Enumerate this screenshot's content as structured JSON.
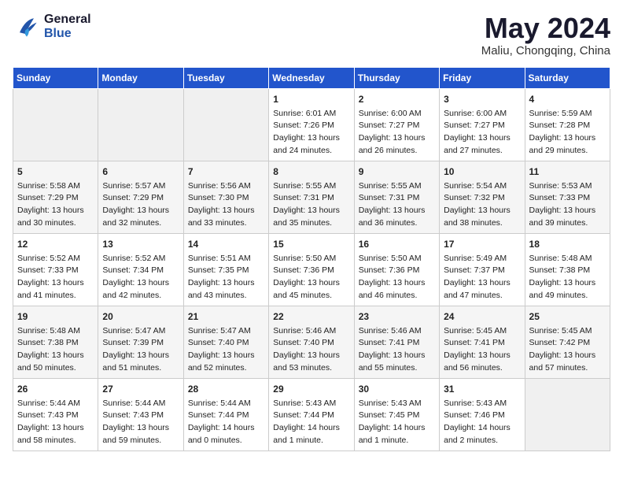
{
  "logo": {
    "line1": "General",
    "line2": "Blue"
  },
  "title": "May 2024",
  "location": "Maliu, Chongqing, China",
  "days_header": [
    "Sunday",
    "Monday",
    "Tuesday",
    "Wednesday",
    "Thursday",
    "Friday",
    "Saturday"
  ],
  "weeks": [
    [
      {
        "day": "",
        "content": ""
      },
      {
        "day": "",
        "content": ""
      },
      {
        "day": "",
        "content": ""
      },
      {
        "day": "1",
        "content": "Sunrise: 6:01 AM\nSunset: 7:26 PM\nDaylight: 13 hours\nand 24 minutes."
      },
      {
        "day": "2",
        "content": "Sunrise: 6:00 AM\nSunset: 7:27 PM\nDaylight: 13 hours\nand 26 minutes."
      },
      {
        "day": "3",
        "content": "Sunrise: 6:00 AM\nSunset: 7:27 PM\nDaylight: 13 hours\nand 27 minutes."
      },
      {
        "day": "4",
        "content": "Sunrise: 5:59 AM\nSunset: 7:28 PM\nDaylight: 13 hours\nand 29 minutes."
      }
    ],
    [
      {
        "day": "5",
        "content": "Sunrise: 5:58 AM\nSunset: 7:29 PM\nDaylight: 13 hours\nand 30 minutes."
      },
      {
        "day": "6",
        "content": "Sunrise: 5:57 AM\nSunset: 7:29 PM\nDaylight: 13 hours\nand 32 minutes."
      },
      {
        "day": "7",
        "content": "Sunrise: 5:56 AM\nSunset: 7:30 PM\nDaylight: 13 hours\nand 33 minutes."
      },
      {
        "day": "8",
        "content": "Sunrise: 5:55 AM\nSunset: 7:31 PM\nDaylight: 13 hours\nand 35 minutes."
      },
      {
        "day": "9",
        "content": "Sunrise: 5:55 AM\nSunset: 7:31 PM\nDaylight: 13 hours\nand 36 minutes."
      },
      {
        "day": "10",
        "content": "Sunrise: 5:54 AM\nSunset: 7:32 PM\nDaylight: 13 hours\nand 38 minutes."
      },
      {
        "day": "11",
        "content": "Sunrise: 5:53 AM\nSunset: 7:33 PM\nDaylight: 13 hours\nand 39 minutes."
      }
    ],
    [
      {
        "day": "12",
        "content": "Sunrise: 5:52 AM\nSunset: 7:33 PM\nDaylight: 13 hours\nand 41 minutes."
      },
      {
        "day": "13",
        "content": "Sunrise: 5:52 AM\nSunset: 7:34 PM\nDaylight: 13 hours\nand 42 minutes."
      },
      {
        "day": "14",
        "content": "Sunrise: 5:51 AM\nSunset: 7:35 PM\nDaylight: 13 hours\nand 43 minutes."
      },
      {
        "day": "15",
        "content": "Sunrise: 5:50 AM\nSunset: 7:36 PM\nDaylight: 13 hours\nand 45 minutes."
      },
      {
        "day": "16",
        "content": "Sunrise: 5:50 AM\nSunset: 7:36 PM\nDaylight: 13 hours\nand 46 minutes."
      },
      {
        "day": "17",
        "content": "Sunrise: 5:49 AM\nSunset: 7:37 PM\nDaylight: 13 hours\nand 47 minutes."
      },
      {
        "day": "18",
        "content": "Sunrise: 5:48 AM\nSunset: 7:38 PM\nDaylight: 13 hours\nand 49 minutes."
      }
    ],
    [
      {
        "day": "19",
        "content": "Sunrise: 5:48 AM\nSunset: 7:38 PM\nDaylight: 13 hours\nand 50 minutes."
      },
      {
        "day": "20",
        "content": "Sunrise: 5:47 AM\nSunset: 7:39 PM\nDaylight: 13 hours\nand 51 minutes."
      },
      {
        "day": "21",
        "content": "Sunrise: 5:47 AM\nSunset: 7:40 PM\nDaylight: 13 hours\nand 52 minutes."
      },
      {
        "day": "22",
        "content": "Sunrise: 5:46 AM\nSunset: 7:40 PM\nDaylight: 13 hours\nand 53 minutes."
      },
      {
        "day": "23",
        "content": "Sunrise: 5:46 AM\nSunset: 7:41 PM\nDaylight: 13 hours\nand 55 minutes."
      },
      {
        "day": "24",
        "content": "Sunrise: 5:45 AM\nSunset: 7:41 PM\nDaylight: 13 hours\nand 56 minutes."
      },
      {
        "day": "25",
        "content": "Sunrise: 5:45 AM\nSunset: 7:42 PM\nDaylight: 13 hours\nand 57 minutes."
      }
    ],
    [
      {
        "day": "26",
        "content": "Sunrise: 5:44 AM\nSunset: 7:43 PM\nDaylight: 13 hours\nand 58 minutes."
      },
      {
        "day": "27",
        "content": "Sunrise: 5:44 AM\nSunset: 7:43 PM\nDaylight: 13 hours\nand 59 minutes."
      },
      {
        "day": "28",
        "content": "Sunrise: 5:44 AM\nSunset: 7:44 PM\nDaylight: 14 hours\nand 0 minutes."
      },
      {
        "day": "29",
        "content": "Sunrise: 5:43 AM\nSunset: 7:44 PM\nDaylight: 14 hours\nand 1 minute."
      },
      {
        "day": "30",
        "content": "Sunrise: 5:43 AM\nSunset: 7:45 PM\nDaylight: 14 hours\nand 1 minute."
      },
      {
        "day": "31",
        "content": "Sunrise: 5:43 AM\nSunset: 7:46 PM\nDaylight: 14 hours\nand 2 minutes."
      },
      {
        "day": "",
        "content": ""
      }
    ]
  ]
}
